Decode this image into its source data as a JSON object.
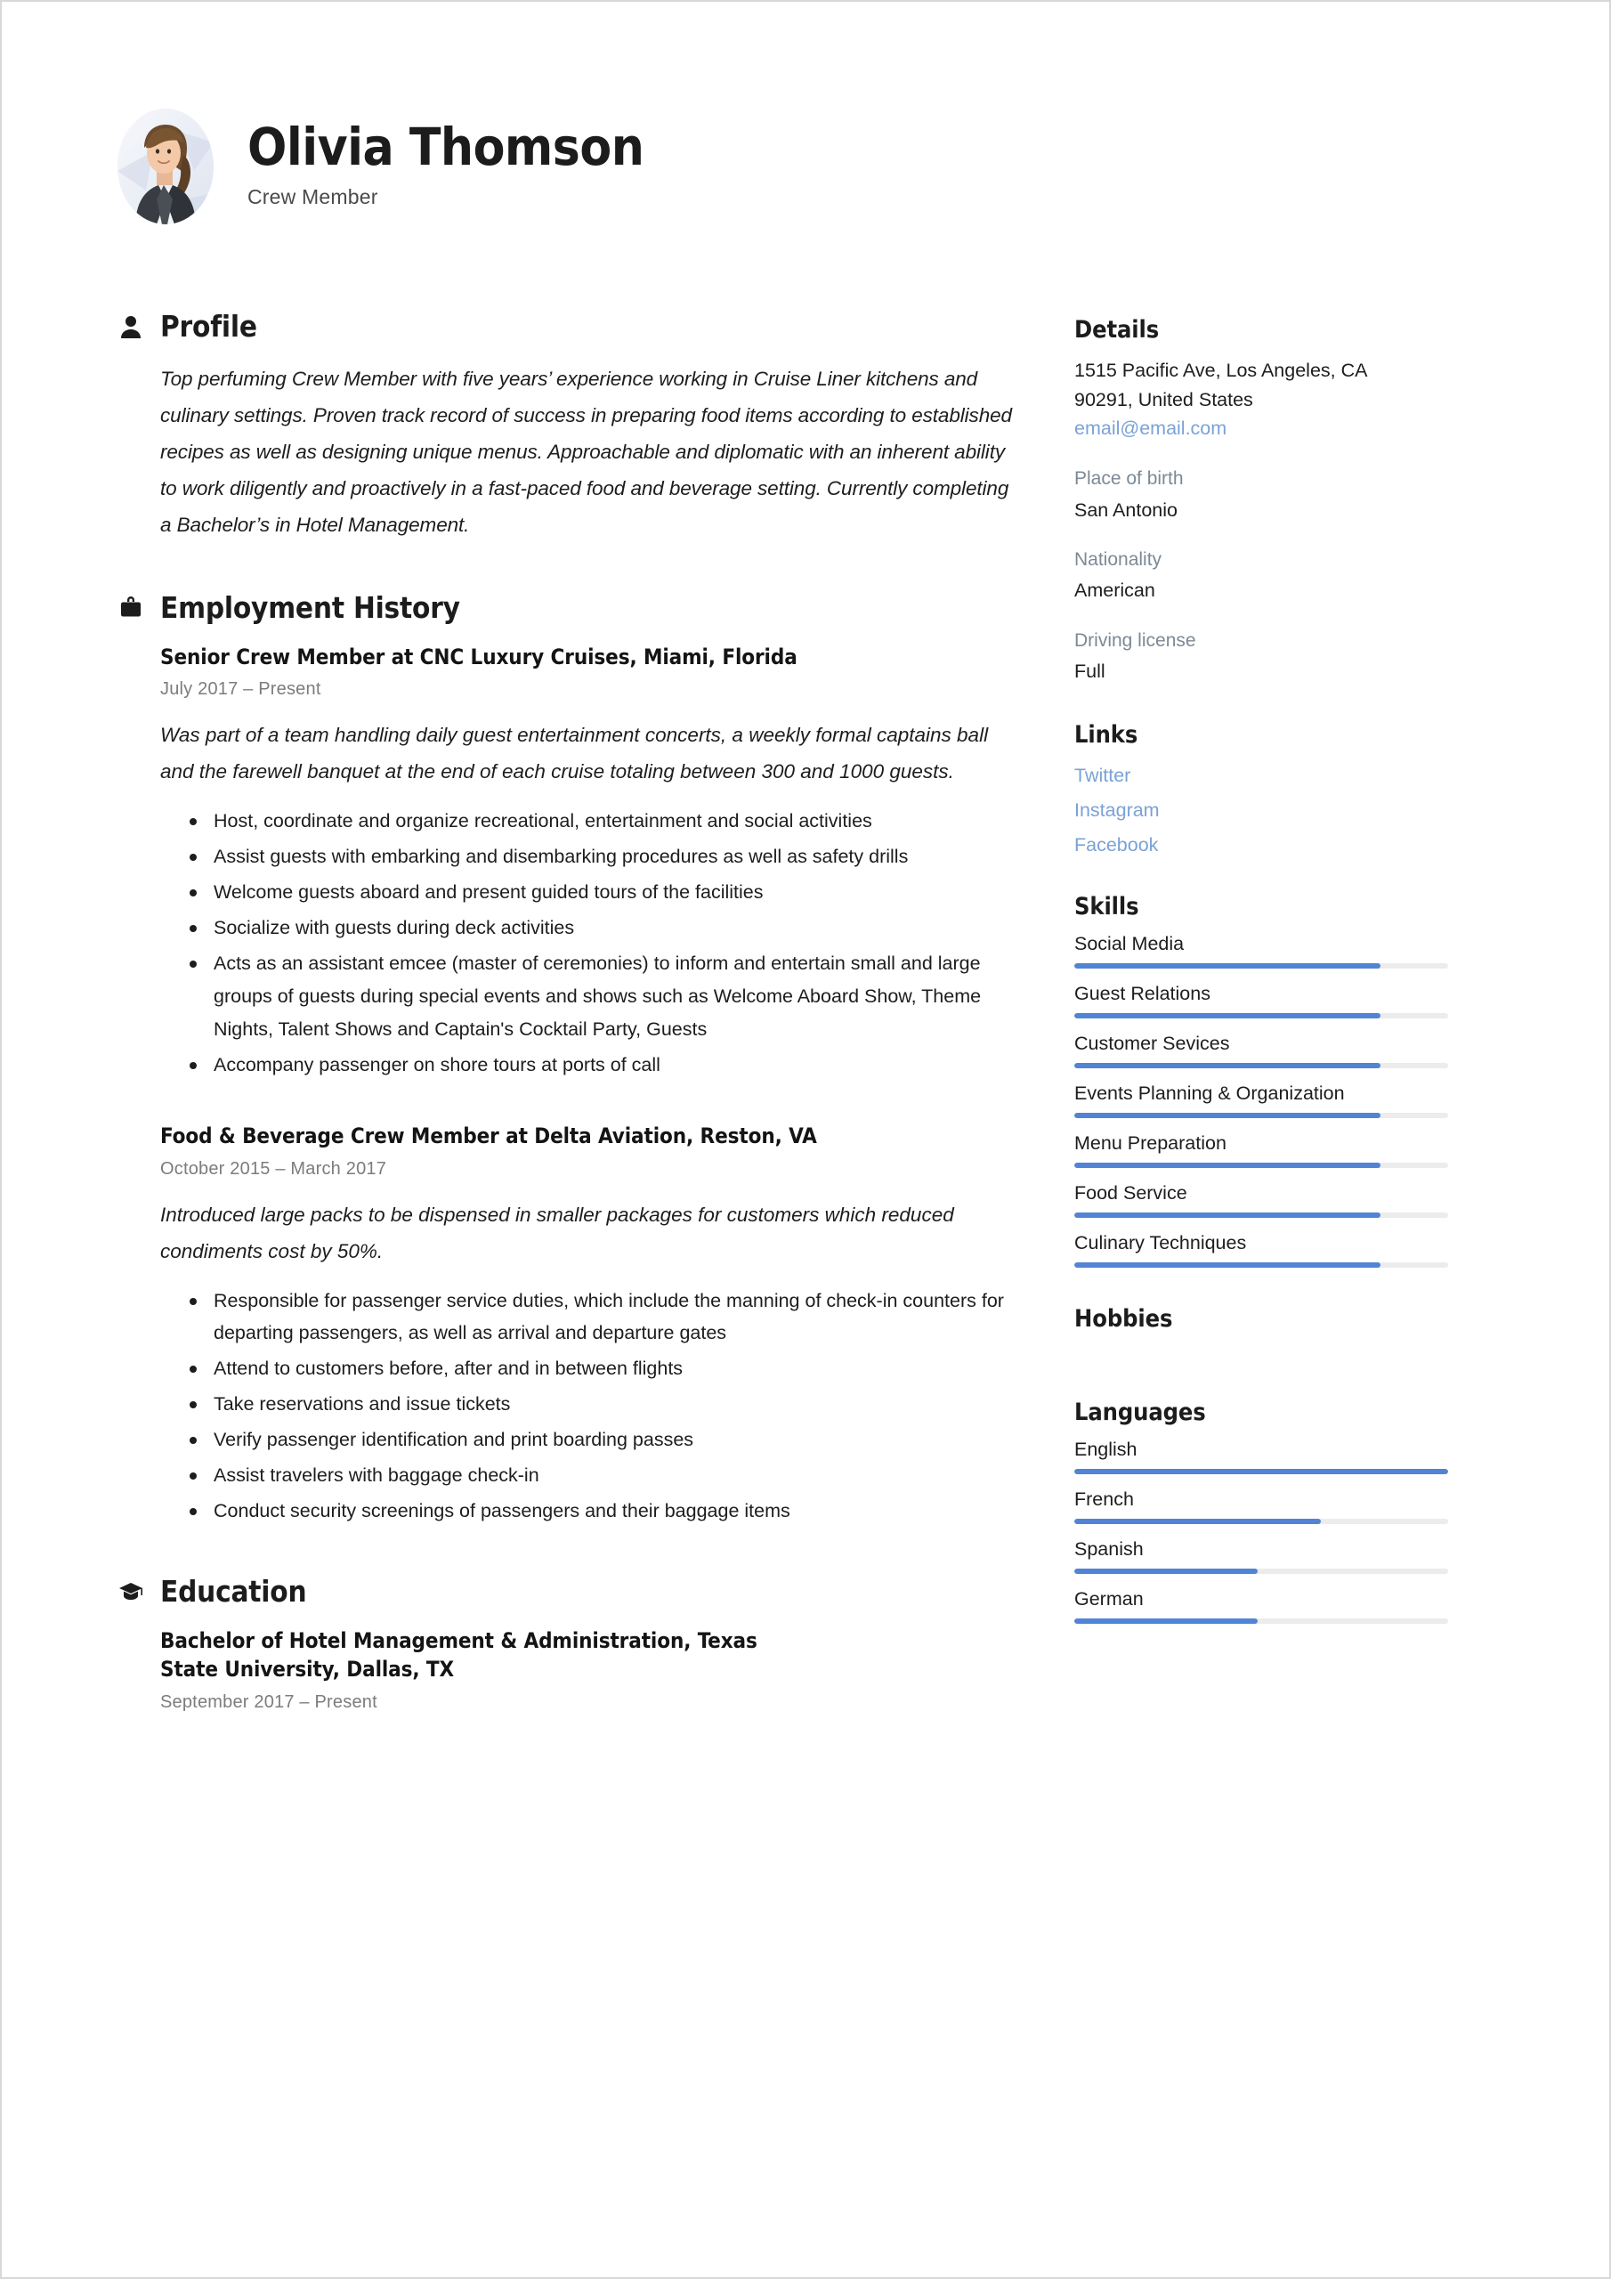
{
  "header": {
    "name": "Olivia Thomson",
    "job_title": "Crew Member",
    "avatar_alt": "profile-photo"
  },
  "main": {
    "profile": {
      "heading": "Profile",
      "icon": "person-icon",
      "text": "Top perfuming Crew Member with five years’ experience working in Cruise Liner kitchens and culinary settings. Proven track record of success in preparing food items according to established recipes as well as designing unique menus. Approachable and diplomatic with an inherent ability to work diligently and proactively in a fast-paced food and beverage setting. Currently completing a Bachelor’s in Hotel Management."
    },
    "employment": {
      "heading": "Employment History",
      "icon": "briefcase-icon",
      "entries": [
        {
          "title": "Senior Crew Member at CNC Luxury Cruises, Miami, Florida",
          "date": "July 2017  –  Present",
          "description": "Was part of a team handling daily guest entertainment concerts, a weekly formal captains ball and the farewell banquet at the end of each cruise totaling between 300 and 1000 guests.",
          "bullets": [
            "Host, coordinate and organize recreational, entertainment and social activities",
            "Assist guests with embarking and disembarking procedures as well as safety drills",
            "Welcome guests aboard and present guided tours of the facilities",
            "Socialize with guests during deck activities",
            "Acts as an assistant emcee (master of ceremonies) to inform and entertain small and large groups of guests during special events and shows such as Welcome Aboard Show, Theme Nights, Talent Shows and Captain's Cocktail Party, Guests",
            "Accompany passenger on shore tours at ports of call"
          ]
        },
        {
          "title": "Food & Beverage Crew Member at Delta Aviation, Reston, VA",
          "date": "October 2015  –  March 2017",
          "description": "Introduced large packs to be dispensed in smaller packages for customers which reduced condiments cost by 50%.",
          "bullets": [
            "Responsible for passenger service duties, which include the manning of check-in counters for departing passengers, as well as arrival and departure gates",
            "Attend to customers before, after and in between flights",
            "Take reservations and issue tickets",
            "Verify passenger identification and print boarding passes",
            "Assist travelers with baggage check-in",
            "Conduct security screenings of passengers and their baggage items"
          ]
        }
      ]
    },
    "education": {
      "heading": "Education",
      "icon": "graduation-cap-icon",
      "entries": [
        {
          "title": "Bachelor of Hotel Management & Administration, Texas State University, Dallas, TX",
          "date": "September 2017  –  Present"
        }
      ]
    }
  },
  "sidebar": {
    "details": {
      "heading": "Details",
      "address_line1": "1515 Pacific Ave, Los Angeles, CA",
      "address_line2": "90291, United States",
      "email": "email@email.com",
      "fields": [
        {
          "label": "Place of birth",
          "value": "San Antonio"
        },
        {
          "label": "Nationality",
          "value": "American"
        },
        {
          "label": "Driving license",
          "value": "Full"
        }
      ]
    },
    "links": {
      "heading": "Links",
      "items": [
        "Twitter",
        "Instagram",
        "Facebook"
      ]
    },
    "skills": {
      "heading": "Skills",
      "items": [
        {
          "label": "Social Media",
          "level": 82
        },
        {
          "label": "Guest Relations",
          "level": 82
        },
        {
          "label": "Customer Sevices",
          "level": 82
        },
        {
          "label": "Events Planning & Organization",
          "level": 82
        },
        {
          "label": "Menu Preparation",
          "level": 82
        },
        {
          "label": "Food Service",
          "level": 82
        },
        {
          "label": "Culinary Techniques",
          "level": 82
        }
      ]
    },
    "hobbies": {
      "heading": "Hobbies",
      "text": ""
    },
    "languages": {
      "heading": "Languages",
      "items": [
        {
          "label": "English",
          "level": 100
        },
        {
          "label": "French",
          "level": 66
        },
        {
          "label": "Spanish",
          "level": 49
        },
        {
          "label": "German",
          "level": 49
        }
      ]
    }
  },
  "colors": {
    "accent": "#5184d4",
    "link": "#7ba2d6",
    "muted": "#7c8995",
    "text": "#1d1d1d",
    "track": "#ececec"
  }
}
